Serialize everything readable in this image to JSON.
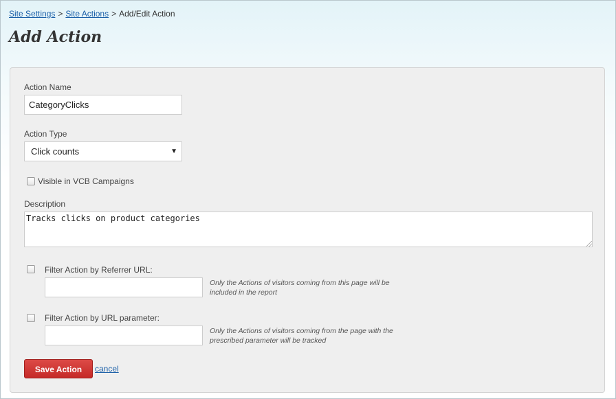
{
  "breadcrumb": {
    "items": [
      {
        "label": "Site Settings"
      },
      {
        "label": "Site Actions"
      },
      {
        "label": "Add/Edit Action"
      }
    ],
    "separator": ">"
  },
  "page": {
    "title": "Add Action"
  },
  "form": {
    "action_name": {
      "label": "Action Name",
      "value": "CategoryClicks"
    },
    "action_type": {
      "label": "Action Type",
      "selected": "Click counts"
    },
    "visible_vcb": {
      "label": "Visible in VCB Campaigns",
      "checked": false
    },
    "description": {
      "label": "Description",
      "value": "Tracks clicks on product categories"
    },
    "filter_referrer": {
      "label": "Filter Action by Referrer URL:",
      "checked": false,
      "value": "",
      "help_line1": "Only the Actions of visitors coming from this page will be",
      "help_line2": "included in the report"
    },
    "filter_param": {
      "label": "Filter Action by URL parameter:",
      "checked": false,
      "value": "",
      "help_line1": "Only the Actions of visitors coming from the page with the",
      "help_line2": "prescribed parameter will be tracked"
    },
    "save_label": "Save Action",
    "cancel_label": "cancel"
  },
  "icons": {
    "select_arrow": "chevron-down-icon",
    "resize_grip": "resize-grip-icon"
  },
  "colors": {
    "primary_button": "#c9302c",
    "link": "#1a5fa8"
  }
}
